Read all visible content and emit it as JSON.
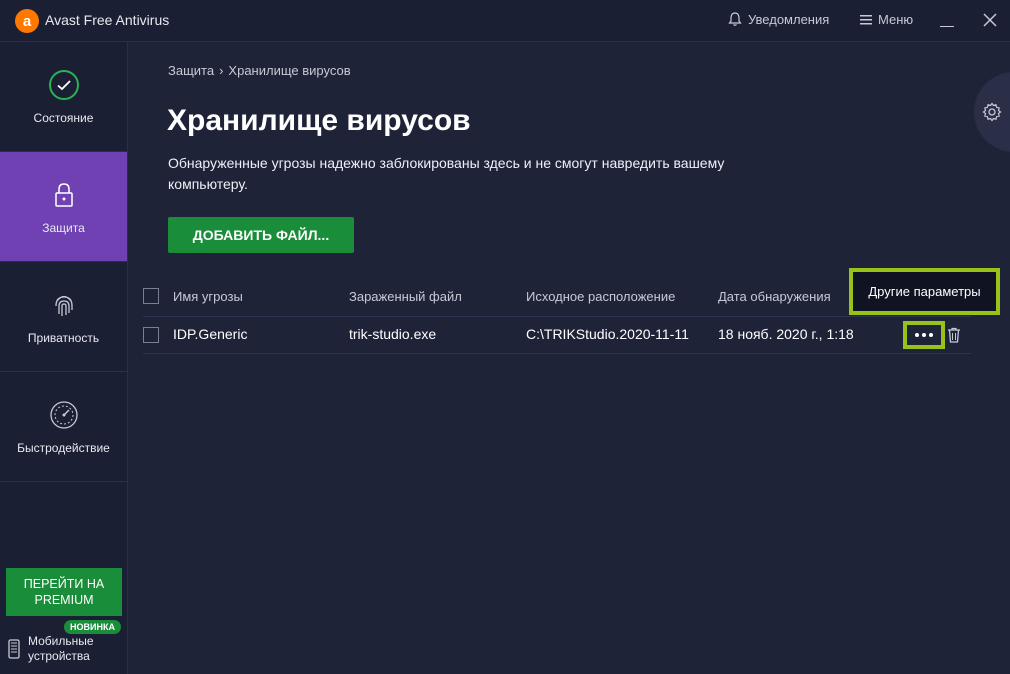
{
  "app": {
    "title": "Avast Free Antivirus",
    "logo_letter": "a"
  },
  "titlebar": {
    "notifications": "Уведомления",
    "menu": "Меню"
  },
  "sidebar": {
    "items": [
      {
        "label": "Состояние",
        "icon": "check-circle-icon"
      },
      {
        "label": "Защита",
        "icon": "lock-icon"
      },
      {
        "label": "Приватность",
        "icon": "fingerprint-icon"
      },
      {
        "label": "Быстродействие",
        "icon": "speedometer-icon"
      }
    ],
    "premium_button": "ПЕРЕЙТИ НА PREMIUM",
    "new_badge": "НОВИНКА",
    "mobile": "Мобильные устройства"
  },
  "breadcrumb": {
    "parent": "Защита",
    "separator": "›",
    "current": "Хранилище вирусов"
  },
  "page": {
    "title": "Хранилище вирусов",
    "description": "Обнаруженные угрозы надежно заблокированы здесь и не смогут навредить вашему компьютеру.",
    "add_button": "ДОБАВИТЬ ФАЙЛ..."
  },
  "table": {
    "headers": [
      "Имя угрозы",
      "Зараженный файл",
      "Исходное расположение",
      "Дата обнаружения"
    ],
    "rows": [
      {
        "threat": "IDP.Generic",
        "file": "trik-studio.exe",
        "location": "C:\\TRIKStudio.2020-11-11",
        "date": "18 нояб. 2020 г., 1:18"
      }
    ]
  },
  "tooltip": "Другие параметры",
  "colors": {
    "accent_green": "#1a8d3a",
    "active_purple": "#7041b3",
    "highlight": "#97c21a",
    "logo_orange": "#ff7800"
  }
}
